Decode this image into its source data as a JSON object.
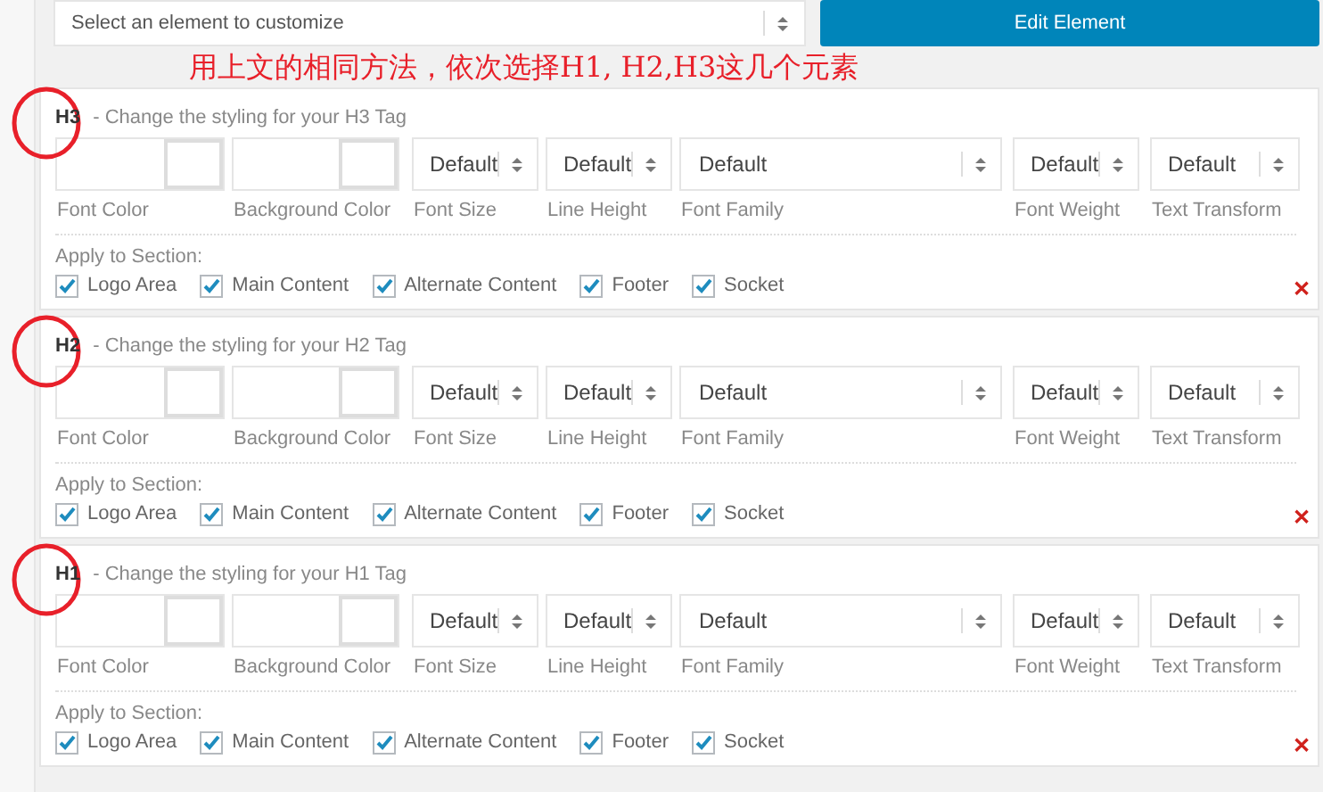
{
  "toolbar": {
    "select": {
      "value": "Select an element to customize"
    },
    "button": "Edit Element"
  },
  "annotation": "用上文的相同方法，依次选择H1, H2,H3这几个元素",
  "sections": [
    {
      "tag": "H3",
      "description": " - Change the styling for your H3 Tag",
      "circled": true,
      "fields": [
        {
          "kind": "color",
          "label": "Font Color"
        },
        {
          "kind": "color",
          "label": "Background Color"
        },
        {
          "kind": "select",
          "value": "Default",
          "label": "Font Size"
        },
        {
          "kind": "select",
          "value": "Default",
          "label": "Line Height"
        },
        {
          "kind": "wide",
          "value": "Default",
          "label": "Font Family"
        },
        {
          "kind": "select",
          "value": "Default",
          "label": "Font Weight"
        },
        {
          "kind": "select",
          "value": "Default",
          "label": "Text Transform"
        }
      ],
      "apply_label": "Apply to Section:",
      "checks": [
        {
          "label": "Logo Area",
          "checked": true
        },
        {
          "label": "Main Content",
          "checked": true
        },
        {
          "label": "Alternate Content",
          "checked": true
        },
        {
          "label": "Footer",
          "checked": true
        },
        {
          "label": "Socket",
          "checked": true
        }
      ],
      "remove": "✕"
    },
    {
      "tag": "H2",
      "description": " - Change the styling for your H2 Tag",
      "circled": true,
      "fields": [
        {
          "kind": "color",
          "label": "Font Color"
        },
        {
          "kind": "color",
          "label": "Background Color"
        },
        {
          "kind": "select",
          "value": "Default",
          "label": "Font Size"
        },
        {
          "kind": "select",
          "value": "Default",
          "label": "Line Height"
        },
        {
          "kind": "wide",
          "value": "Default",
          "label": "Font Family"
        },
        {
          "kind": "select",
          "value": "Default",
          "label": "Font Weight"
        },
        {
          "kind": "select",
          "value": "Default",
          "label": "Text Transform"
        }
      ],
      "apply_label": "Apply to Section:",
      "checks": [
        {
          "label": "Logo Area",
          "checked": true
        },
        {
          "label": "Main Content",
          "checked": true
        },
        {
          "label": "Alternate Content",
          "checked": true
        },
        {
          "label": "Footer",
          "checked": true
        },
        {
          "label": "Socket",
          "checked": true
        }
      ],
      "remove": "✕"
    },
    {
      "tag": "H1",
      "description": " - Change the styling for your H1 Tag",
      "circled": true,
      "fields": [
        {
          "kind": "color",
          "label": "Font Color"
        },
        {
          "kind": "color",
          "label": "Background Color"
        },
        {
          "kind": "select",
          "value": "Default",
          "label": "Font Size"
        },
        {
          "kind": "select",
          "value": "Default",
          "label": "Line Height"
        },
        {
          "kind": "wide",
          "value": "Default",
          "label": "Font Family"
        },
        {
          "kind": "select",
          "value": "Default",
          "label": "Font Weight"
        },
        {
          "kind": "select",
          "value": "Default",
          "label": "Text Transform"
        }
      ],
      "apply_label": "Apply to Section:",
      "checks": [
        {
          "label": "Logo Area",
          "checked": true
        },
        {
          "label": "Main Content",
          "checked": true
        },
        {
          "label": "Alternate Content",
          "checked": true
        },
        {
          "label": "Footer",
          "checked": true
        },
        {
          "label": "Socket",
          "checked": true
        }
      ],
      "remove": "✕"
    }
  ]
}
